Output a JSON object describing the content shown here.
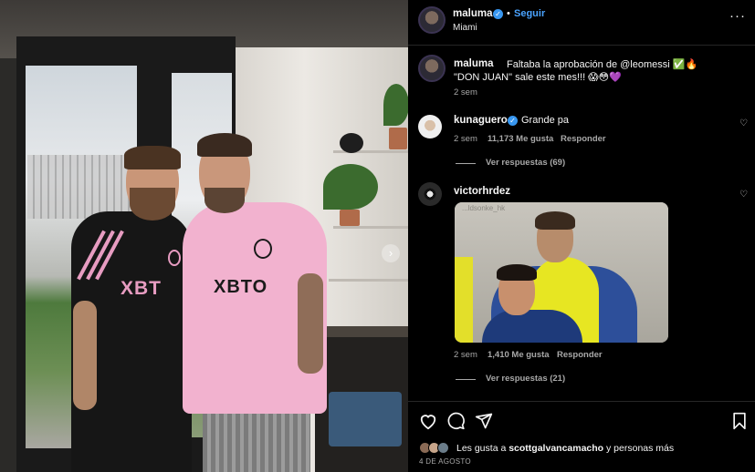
{
  "post": {
    "photo": {
      "shirt_left_text": "XBT",
      "shirt_right_text": "XBTO",
      "carousel_icon": "chevron-right-icon"
    },
    "header": {
      "username": "maluma",
      "dot": "•",
      "follow_label": "Seguir",
      "location": "Miami",
      "more_label": "···"
    },
    "caption": {
      "username": "maluma",
      "text_line1": "Faltaba la aprobación de @leomessi ✅🔥",
      "text_line2": "\"DON JUAN\" sale este mes!!! 😱😳💜",
      "time": "2 sem"
    },
    "comments": [
      {
        "username": "kunaguero",
        "text": "Grande pa",
        "time": "2 sem",
        "likes": "11,173 Me gusta",
        "reply_label": "Responder",
        "view_replies": "Ver respuestas (69)"
      },
      {
        "username": "victorhrdez",
        "gif_watermark": "...ldsonke_hk",
        "time": "2 sem",
        "likes": "1,410 Me gusta",
        "reply_label": "Responder",
        "view_replies": "Ver respuestas (21)"
      }
    ],
    "actions": {
      "like_icon": "heart-icon",
      "comment_icon": "comment-icon",
      "share_icon": "send-icon",
      "save_icon": "bookmark-icon"
    },
    "likes": {
      "prefix": "Les gusta a",
      "user": "scottgalvancamacho",
      "suffix": "y personas más"
    },
    "date": "4 DE AGOSTO"
  },
  "colors": {
    "background": "#000000",
    "link_blue": "#4aa3ff",
    "verified_blue": "#3897f0",
    "secondary_text": "#a8a8a8",
    "shirt_pink": "#f2b2cf"
  }
}
